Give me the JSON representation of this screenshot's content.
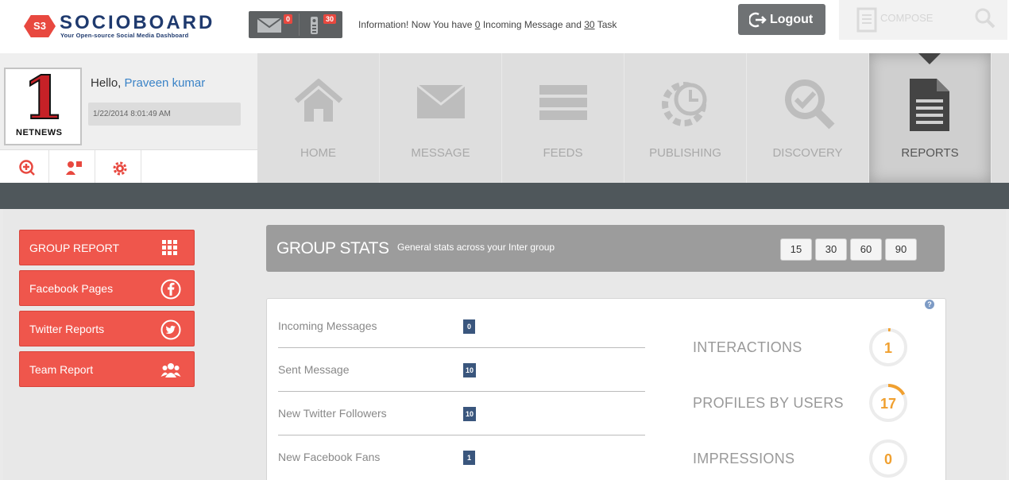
{
  "app": {
    "logo_text": "SOCIOBOARD",
    "logo_badge": "S3",
    "tagline": "Your Open-source Social Media Dashboard"
  },
  "header": {
    "messages_count": "0",
    "tasks_count": "30",
    "info_prefix": "Information! Now You have",
    "info_incoming": "0",
    "info_middle": "Incoming Message and",
    "info_tasks": "30",
    "info_suffix": "Task",
    "logout_label": "Logout",
    "compose_label": "COMPOSE"
  },
  "profile": {
    "avatar_text_big": "1",
    "avatar_text_small": "NETNEWS",
    "greeting": "Hello,",
    "name": "Praveen kumar",
    "date": "1/22/2014 8:01:49 AM"
  },
  "nav": {
    "items": [
      {
        "label": "HOME",
        "icon": "home-icon"
      },
      {
        "label": "MESSAGE",
        "icon": "envelope-icon"
      },
      {
        "label": "FEEDS",
        "icon": "list-icon"
      },
      {
        "label": "PUBLISHING",
        "icon": "gear-clock-icon"
      },
      {
        "label": "DISCOVERY",
        "icon": "magnify-check-icon"
      },
      {
        "label": "REPORTS",
        "icon": "document-icon"
      }
    ],
    "active": "REPORTS"
  },
  "sidebar": {
    "buttons": [
      {
        "label": "GROUP REPORT",
        "icon": "grid-icon"
      },
      {
        "label": "Facebook Pages",
        "icon": "facebook-icon"
      },
      {
        "label": "Twitter Reports",
        "icon": "twitter-icon"
      },
      {
        "label": "Team Report",
        "icon": "team-icon"
      }
    ]
  },
  "stats": {
    "title": "GROUP STATS",
    "subtitle": "General stats across your Inter group",
    "ranges": [
      "15",
      "30",
      "60",
      "90"
    ],
    "help": "?",
    "rows": [
      {
        "label": "Incoming Messages",
        "value": "0"
      },
      {
        "label": "Sent Message",
        "value": "10"
      },
      {
        "label": "New Twitter Followers",
        "value": "10"
      },
      {
        "label": "New Facebook Fans",
        "value": "1"
      }
    ],
    "metrics": [
      {
        "label": "INTERACTIONS",
        "value": "1",
        "ring_fraction": 0.02
      },
      {
        "label": "PROFILES BY USERS",
        "value": "17",
        "ring_fraction": 0.17
      },
      {
        "label": "IMPRESSIONS",
        "value": "0",
        "ring_fraction": 0
      }
    ]
  },
  "colors": {
    "accent_red": "#ef564c",
    "navy": "#1f3a6e",
    "value_badge": "#3a567d",
    "ring_orange": "#f0a030"
  }
}
